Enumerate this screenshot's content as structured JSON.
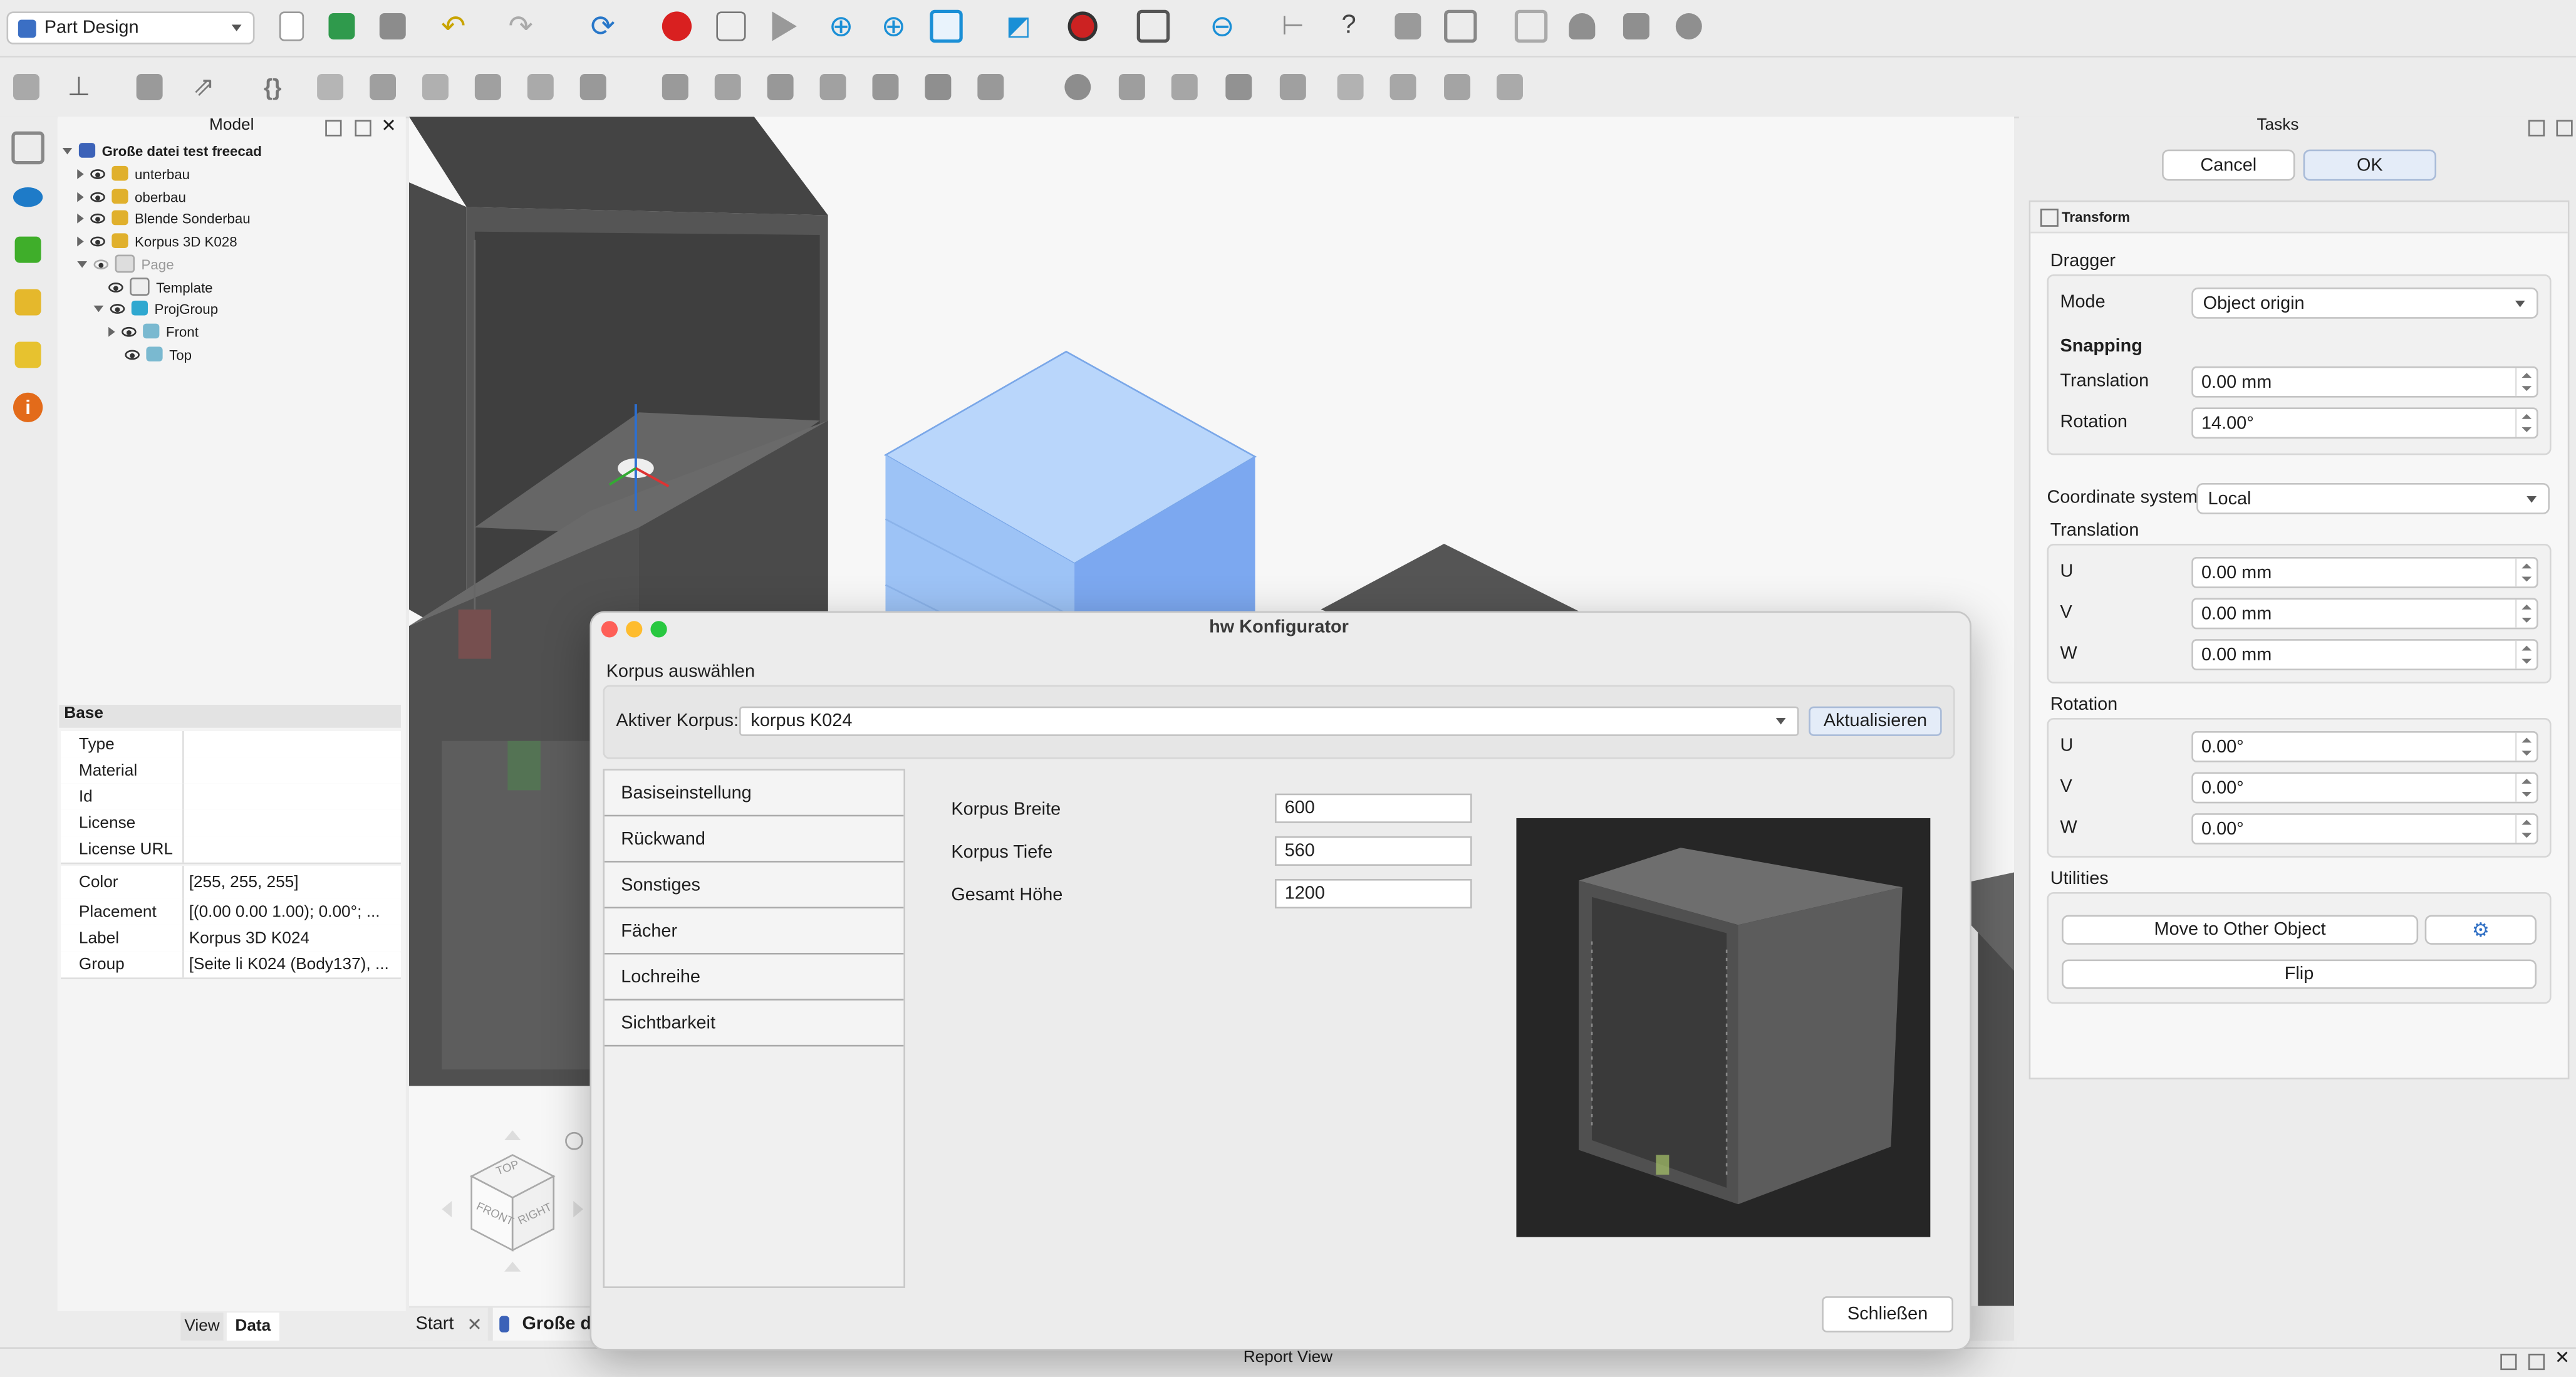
{
  "workbench": "Part Design",
  "colors": {
    "accent": "#2f7bd6",
    "selection_blue": "#8ab4f8",
    "viewport_bg": "#f7f7f7",
    "dialog_preview_bg": "#262626",
    "record_red": "#d92020"
  },
  "tree": {
    "title": "Model",
    "root": "Große datei test freecad",
    "items": [
      {
        "label": "unterbau"
      },
      {
        "label": "oberbau"
      },
      {
        "label": "Blende Sonderbau"
      },
      {
        "label": "Korpus 3D  K028"
      },
      {
        "label": "Page"
      },
      {
        "label": "Template"
      },
      {
        "label": "ProjGroup"
      },
      {
        "label": "Front"
      },
      {
        "label": "Top"
      }
    ]
  },
  "props": {
    "group": "Base",
    "rows": [
      {
        "k": "Type",
        "v": ""
      },
      {
        "k": "Material",
        "v": ""
      },
      {
        "k": "Id",
        "v": ""
      },
      {
        "k": "License",
        "v": ""
      },
      {
        "k": "License URL",
        "v": ""
      },
      {
        "k": "Color",
        "v": "[255, 255, 255]"
      },
      {
        "k": "Placement",
        "v": "[(0.00 0.00 1.00); 0.00°; ..."
      },
      {
        "k": "Label",
        "v": "Korpus 3D  K024"
      },
      {
        "k": "Group",
        "v": "[Seite li K024 (Body137), ..."
      }
    ],
    "tabs": [
      "View",
      "Data"
    ]
  },
  "doc_tabs": [
    "Start",
    "Große d"
  ],
  "report_view": "Report View",
  "navcube": {
    "top": "TOP",
    "front": "FRONT",
    "right": "RIGHT"
  },
  "tasks": {
    "title": "Tasks",
    "cancel": "Cancel",
    "ok": "OK",
    "transform": "Transform",
    "dragger": "Dragger",
    "mode_label": "Mode",
    "mode_value": "Object origin",
    "snapping": "Snapping",
    "snap_translation_label": "Translation",
    "snap_translation": "0.00 mm",
    "snap_rotation_label": "Rotation",
    "snap_rotation": "14.00°",
    "coord_label": "Coordinate system",
    "coord_value": "Local",
    "translation": "Translation",
    "t_u": "0.00 mm",
    "t_v": "0.00 mm",
    "t_w": "0.00 mm",
    "rotation": "Rotation",
    "r_u": "0.00°",
    "r_v": "0.00°",
    "r_w": "0.00°",
    "u": "U",
    "v": "V",
    "w": "W",
    "utilities": "Utilities",
    "move_other": "Move to Other Object",
    "flip": "Flip"
  },
  "dialog": {
    "title": "hw Konfigurator",
    "section": "Korpus auswählen",
    "active_label": "Aktiver Korpus:",
    "active_value": "korpus K024",
    "refresh": "Aktualisieren",
    "tabs": [
      "Basiseinstellung",
      "Rückwand",
      "Sonstiges",
      "Fächer",
      "Lochreihe",
      "Sichtbarkeit"
    ],
    "fields": [
      {
        "label": "Korpus Breite",
        "value": "600"
      },
      {
        "label": "Korpus Tiefe",
        "value": "560"
      },
      {
        "label": "Gesamt Höhe",
        "value": "1200"
      }
    ],
    "close": "Schließen"
  }
}
